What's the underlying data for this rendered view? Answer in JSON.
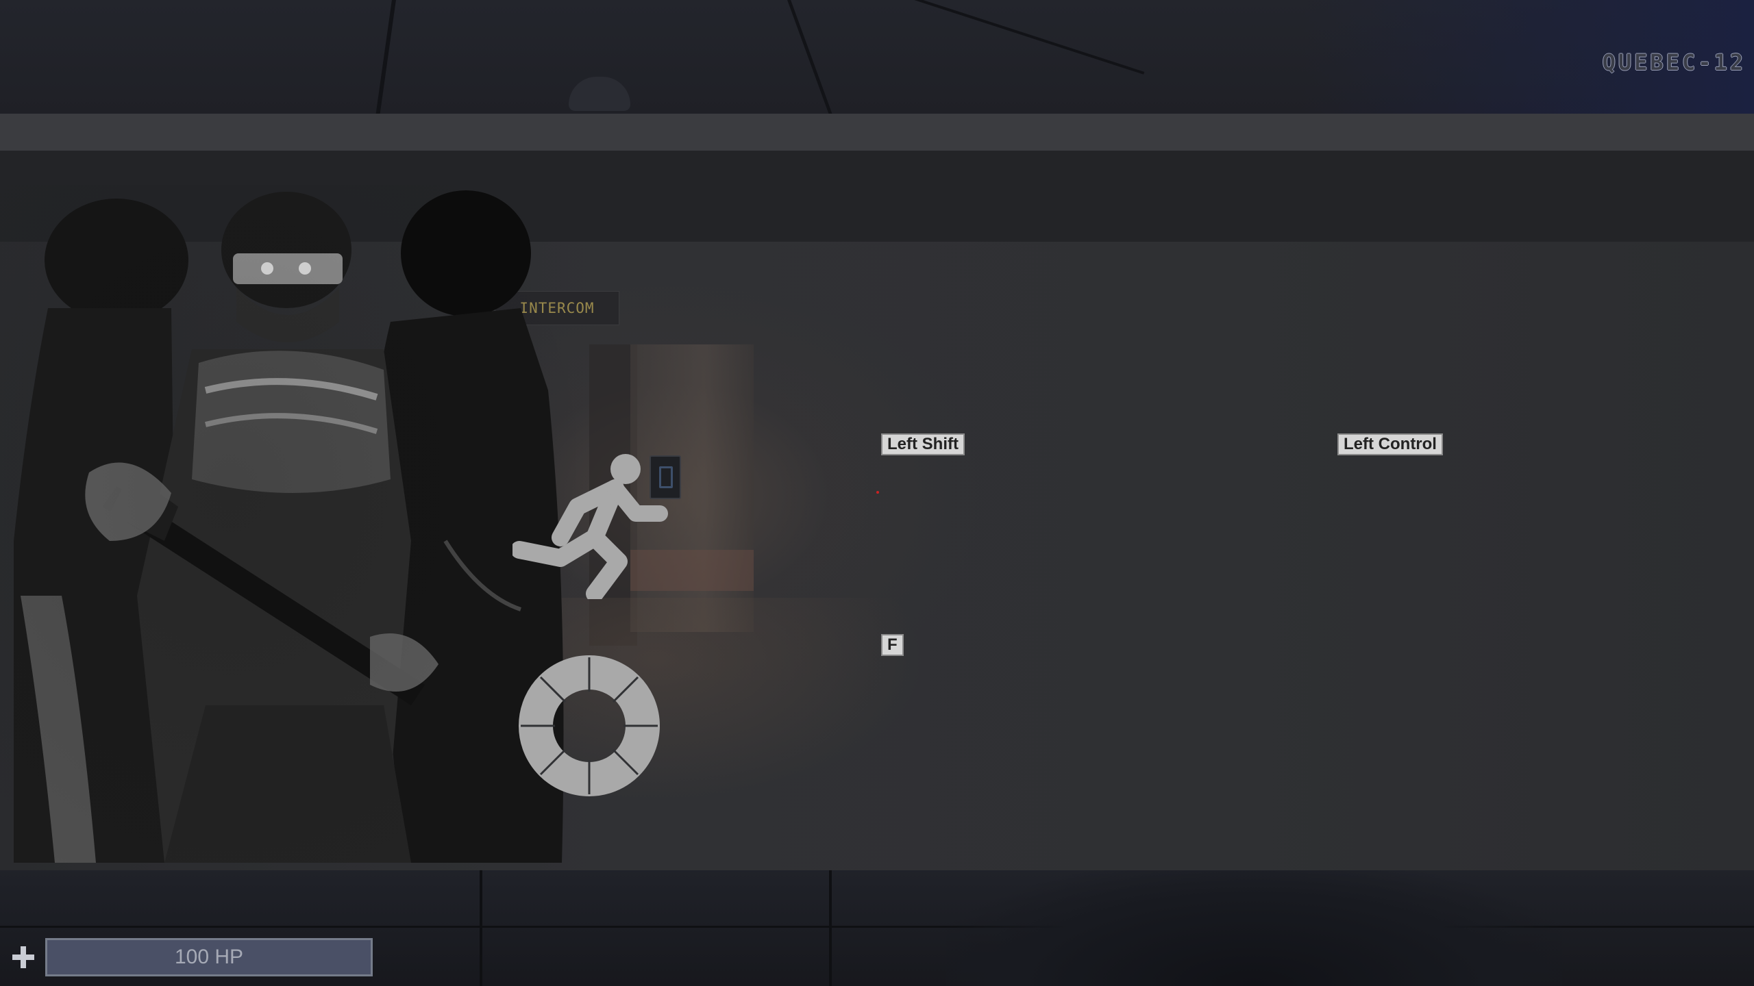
{
  "hud": {
    "location": "QUEBEC-12",
    "health": {
      "label": "100 HP",
      "fraction": 1.0
    },
    "health_icon": "plus-icon"
  },
  "scene": {
    "sign_text": "INTERCOM"
  },
  "controls": {
    "sprint": {
      "icon": "running-person-icon",
      "key": "Left Shift"
    },
    "crouch": {
      "key": "Left Control"
    },
    "interact": {
      "icon": "ring-wheel-icon",
      "key": "F"
    }
  },
  "colors": {
    "panel": "#303134",
    "icon_gray": "#a9a9a9",
    "key_bg": "#d6d6d6",
    "health_fill": "#4a5066"
  }
}
